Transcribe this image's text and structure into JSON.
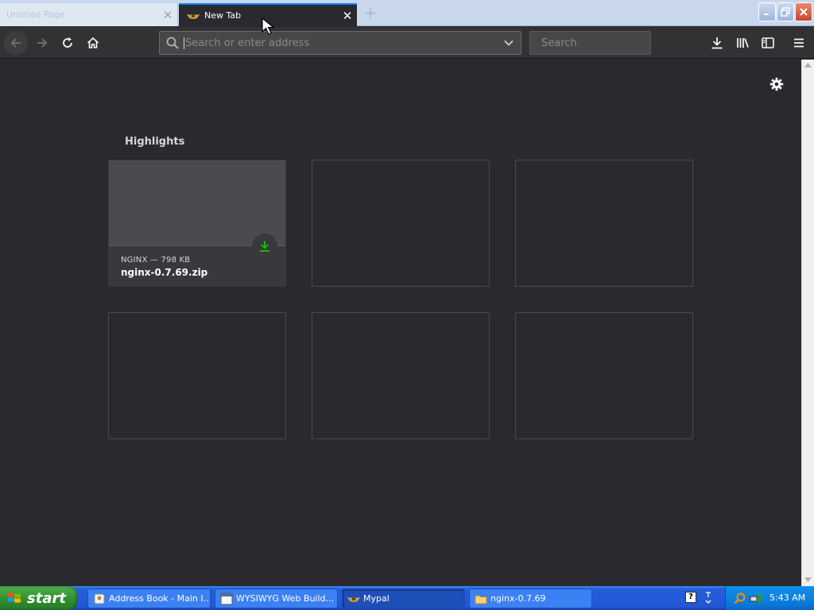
{
  "browser": {
    "tabs": [
      {
        "label": "Untitled Page",
        "active": false
      },
      {
        "label": "New Tab",
        "active": true
      }
    ],
    "new_tab_symbol": "+",
    "close_symbol": "✕",
    "window_controls": [
      "minimize",
      "maximize",
      "close"
    ]
  },
  "toolbar": {
    "address_placeholder": "Search or enter address",
    "search_placeholder": "Search",
    "icons": [
      "back-icon",
      "forward-icon",
      "reload-icon",
      "home-icon",
      "download-icon",
      "library-icon",
      "sidebar-icon",
      "menu-icon"
    ]
  },
  "newtab": {
    "section_title": "Highlights",
    "highlight": {
      "context": "NGINX — 798 KB",
      "title": "nginx-0.7.69.zip",
      "badge_icon": "download-icon",
      "badge_color": "#12bc00"
    },
    "empty_slots": 5
  },
  "taskbar": {
    "start_label": "start",
    "items": [
      {
        "label": "Address Book - Main I...",
        "icon": "address-book-icon",
        "active": false
      },
      {
        "label": "WYSIWYG Web Build...",
        "icon": "wysiwyg-icon",
        "active": false
      },
      {
        "label": "Mypal",
        "icon": "mypal-icon",
        "active": true
      },
      {
        "label": "nginx-0.7.69",
        "icon": "folder-icon",
        "active": false
      }
    ],
    "clock": "5:43 AM",
    "help_symbol": "?"
  },
  "colors": {
    "background": "#2a2a2e",
    "accent": "#0a84ff",
    "taskbar": "#245edb",
    "start": "#2e8c2e"
  }
}
